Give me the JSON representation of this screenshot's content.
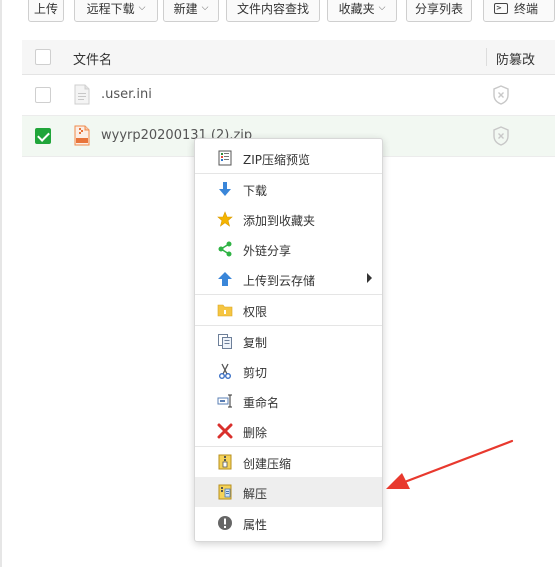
{
  "toolbar": {
    "upload": "上传",
    "remote_download": "远程下载",
    "new": "新建",
    "search_content": "文件内容查找",
    "favorites": "收藏夹",
    "share_list": "分享列表",
    "terminal": "终端"
  },
  "table": {
    "col_filename": "文件名",
    "col_tamper": "防篡改",
    "rows": [
      {
        "name": ".user.ini",
        "checked": false,
        "type": "text"
      },
      {
        "name": "wyyrp20200131 (2).zip",
        "checked": true,
        "type": "zip"
      }
    ]
  },
  "context_menu": {
    "items": [
      {
        "label": "ZIP压缩预览",
        "icon": "zip-preview-icon"
      },
      {
        "label": "下载",
        "icon": "download-icon"
      },
      {
        "label": "添加到收藏夹",
        "icon": "star-icon"
      },
      {
        "label": "外链分享",
        "icon": "share-icon"
      },
      {
        "label": "上传到云存储",
        "icon": "cloud-upload-icon",
        "submenu": true
      },
      {
        "label": "权限",
        "icon": "folder-permission-icon"
      },
      {
        "label": "复制",
        "icon": "copy-icon"
      },
      {
        "label": "剪切",
        "icon": "scissors-icon"
      },
      {
        "label": "重命名",
        "icon": "rename-icon"
      },
      {
        "label": "删除",
        "icon": "delete-icon"
      },
      {
        "label": "创建压缩",
        "icon": "compress-icon"
      },
      {
        "label": "解压",
        "icon": "extract-icon",
        "highlighted": true
      },
      {
        "label": "属性",
        "icon": "info-icon"
      }
    ]
  },
  "colors": {
    "accent_green": "#20a53a",
    "arrow_red": "#e8392e"
  }
}
